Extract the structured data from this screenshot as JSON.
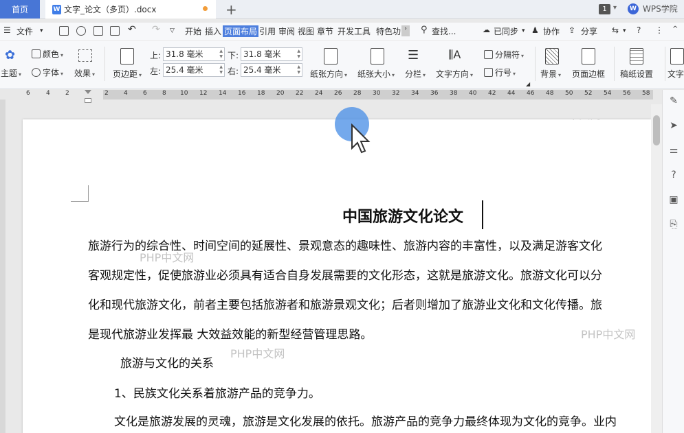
{
  "tabbar": {
    "home": "首页",
    "doc_icon": "W",
    "doc_title": "文字_论文（多页）.docx",
    "plus": "+",
    "badge": "1",
    "wps_logo": "W",
    "wps_academy": "WPS学院"
  },
  "menubar": {
    "file": "文件",
    "items": [
      "开始",
      "插入",
      "页面布局",
      "引用",
      "审阅",
      "视图",
      "章节",
      "开发工具",
      "特色功"
    ],
    "active": "页面布局",
    "search": "查找...",
    "synced": "已同步",
    "collaborate": "协作",
    "share": "分享"
  },
  "ribbon": {
    "theme": "主题",
    "color": "颜色",
    "font": "字体",
    "effect": "效果",
    "margins": "页边距",
    "top_label": "上:",
    "top_value": "31.8 毫米",
    "bottom_label": "下:",
    "bottom_value": "31.8 毫米",
    "left_label": "左:",
    "left_value": "25.4 毫米",
    "right_label": "右:",
    "right_value": "25.4 毫米",
    "orientation": "纸张方向",
    "size": "纸张大小",
    "columns": "分栏",
    "text_direction": "文字方向",
    "breaks": "分隔符",
    "line_numbers": "行号",
    "background": "背景",
    "page_border": "页面边框",
    "manuscript": "稿纸设置",
    "text_wrap": "文字"
  },
  "ruler": {
    "left_labels": [
      "6",
      "4",
      "2"
    ],
    "labels": [
      "2",
      "4",
      "6",
      "8",
      "10",
      "12",
      "14",
      "16",
      "18",
      "20",
      "22",
      "24",
      "26",
      "28",
      "30",
      "32",
      "34",
      "36",
      "38",
      "40",
      "42",
      "44",
      "46",
      "48",
      "50",
      "52",
      "54",
      "56",
      "58"
    ]
  },
  "document": {
    "title": "中国旅游文化论文",
    "lines": [
      "旅游行为的综合性、时间空间的延展性、景观意态的趣味性、旅游内容的丰富性，以及满足游客文化",
      "客观规定性，促使旅游业必须具有适合自身发展需要的文化形态，这就是旅游文化。旅游文化可以分",
      "化和现代旅游文化，前者主要包括旅游者和旅游景观文化；后者则增加了旅游业文化和文化传播。旅",
      "是现代旅游业发挥最  大效益效能的新型经营管理思路。"
    ],
    "heading": "旅游与文化的关系",
    "subheading": "1、民族文化关系着旅游产品的竞争力。",
    "last_line": "文化是旅游发展的灵魂，旅游是文化发展的依托。旅游产品的竞争力最终体现为文化的竞争。业内"
  },
  "watermark": {
    "text": "PHP中文网"
  }
}
